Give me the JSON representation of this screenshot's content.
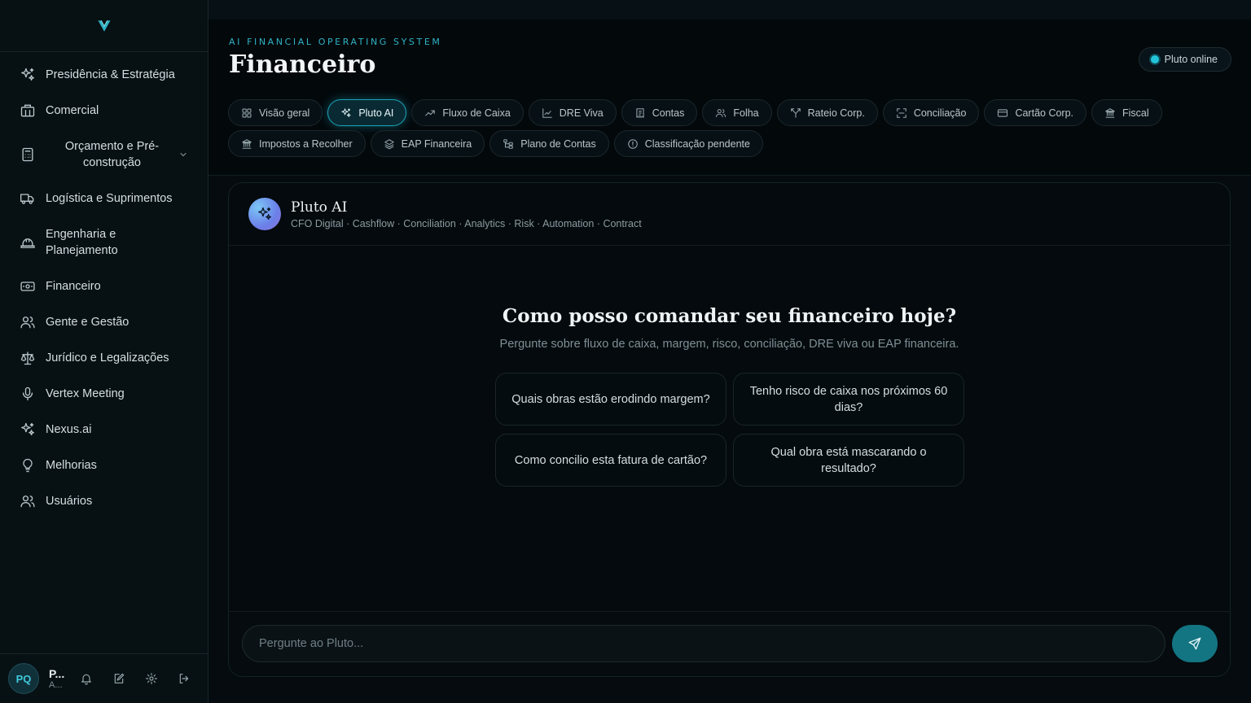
{
  "sidebar": {
    "nav": [
      {
        "label": "Presidência & Estratégia",
        "icon": "sparkles-icon"
      },
      {
        "label": "Comercial",
        "icon": "building-icon"
      },
      {
        "label": "Orçamento e Pré-construção",
        "icon": "calculator-icon"
      },
      {
        "label": "Logística e Suprimentos",
        "icon": "truck-icon"
      },
      {
        "label": "Engenharia e Planejamento",
        "icon": "hard-hat-icon"
      },
      {
        "label": "Financeiro",
        "icon": "banknote-icon"
      },
      {
        "label": "Gente e Gestão",
        "icon": "users-icon"
      },
      {
        "label": "Jurídico e Legalizações",
        "icon": "scale-icon"
      },
      {
        "label": "Vertex Meeting",
        "icon": "microphone-icon"
      },
      {
        "label": "Nexus.ai",
        "icon": "sparkles-icon"
      },
      {
        "label": "Melhorias",
        "icon": "lightbulb-icon"
      },
      {
        "label": "Usuários",
        "icon": "users-icon"
      }
    ],
    "user": {
      "initials": "PQ",
      "name": "P...",
      "role": "A..."
    }
  },
  "header": {
    "eyebrow": "AI FINANCIAL OPERATING SYSTEM",
    "title": "Financeiro",
    "status": "Pluto online"
  },
  "tabs": {
    "row1": [
      {
        "label": "Visão geral",
        "icon": "grid-icon"
      },
      {
        "label": "Pluto AI",
        "icon": "sparkles-icon",
        "active": true
      },
      {
        "label": "Fluxo de Caixa",
        "icon": "trending-up-icon"
      },
      {
        "label": "DRE Viva",
        "icon": "line-chart-icon"
      },
      {
        "label": "Contas",
        "icon": "receipt-icon"
      },
      {
        "label": "Folha",
        "icon": "users-icon"
      },
      {
        "label": "Rateio Corp.",
        "icon": "split-icon"
      },
      {
        "label": "Conciliação",
        "icon": "scan-icon"
      },
      {
        "label": "Cartão Corp.",
        "icon": "credit-card-icon"
      },
      {
        "label": "Fiscal",
        "icon": "landmark-icon"
      }
    ],
    "row2": [
      {
        "label": "Impostos a Recolher",
        "icon": "landmark-icon"
      },
      {
        "label": "EAP Financeira",
        "icon": "layers-icon"
      },
      {
        "label": "Plano de Contas",
        "icon": "tree-icon"
      },
      {
        "label": "Classificação pendente",
        "icon": "alert-circle-icon"
      }
    ]
  },
  "chat": {
    "bot_name": "Pluto AI",
    "bot_subtitle": "CFO Digital · Cashflow · Conciliation · Analytics · Risk · Automation · Contract",
    "welcome_title": "Como posso comandar seu financeiro hoje?",
    "welcome_subtitle": "Pergunte sobre fluxo de caixa, margem, risco, conciliação, DRE viva ou EAP financeira.",
    "suggestions": [
      "Quais obras estão erodindo margem?",
      "Tenho risco de caixa nos próximos 60 dias?",
      "Como concilio esta fatura de cartão?",
      "Qual obra está mascarando o resultado?"
    ],
    "input_placeholder": "Pergunte ao Pluto...",
    "input_value": ""
  },
  "colors": {
    "accent": "#22c3d8",
    "background": "#050b0f",
    "send_button": "#137482"
  }
}
